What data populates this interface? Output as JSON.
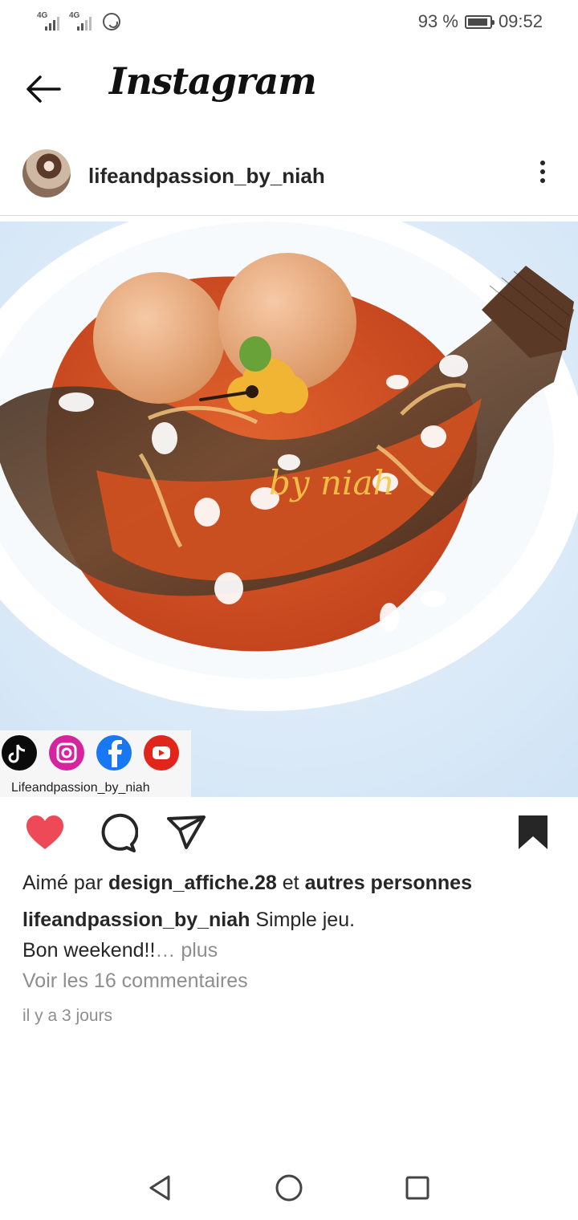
{
  "status_bar": {
    "network_1": "4G",
    "network_2": "4G",
    "battery_percent": "93 %",
    "battery_level": 0.93,
    "time": "09:52",
    "icons": [
      "signal-icon",
      "signal-icon",
      "whatsapp-icon",
      "battery-icon"
    ]
  },
  "app_bar": {
    "title": "Instagram"
  },
  "post": {
    "username": "lifeandpassion_by_niah",
    "image_watermark": "by niah",
    "image_footer_handle": "Lifeandpassion_by_niah",
    "liked_by_prefix": "Aimé par",
    "liked_by_user": "design_affiche.28",
    "liked_by_joiner": "et",
    "liked_by_others": "autres personnes",
    "caption_user": "lifeandpassion_by_niah",
    "caption_line1": "Simple jeu.",
    "caption_line2": "Bon weekend!!",
    "caption_more": "… plus",
    "comments_link": "Voir les 16 commentaires",
    "timestamp": "il y a 3 jours",
    "liked": true,
    "saved": true
  },
  "colors": {
    "like_red": "#ed4956",
    "text": "#262626",
    "muted": "#8e8e8e"
  }
}
